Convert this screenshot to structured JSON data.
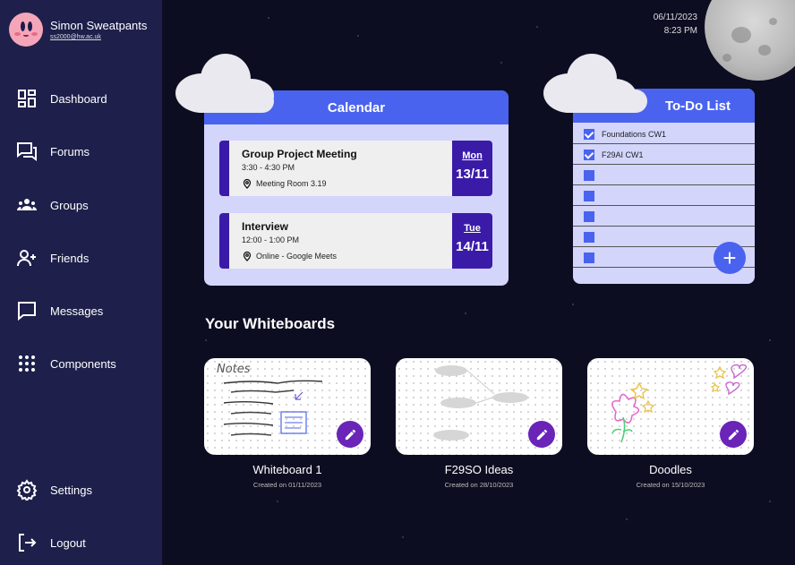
{
  "user": {
    "name": "Simon Sweatpants",
    "email": "ss2000@hw.ac.uk"
  },
  "datetime": {
    "date": "06/11/2023",
    "time": "8:23 PM"
  },
  "nav": [
    {
      "label": "Dashboard",
      "icon": "dashboard-icon"
    },
    {
      "label": "Forums",
      "icon": "forums-icon"
    },
    {
      "label": "Groups",
      "icon": "groups-icon"
    },
    {
      "label": "Friends",
      "icon": "add-friend-icon"
    },
    {
      "label": "Messages",
      "icon": "message-icon"
    },
    {
      "label": "Components",
      "icon": "grid-dots-icon"
    }
  ],
  "nav_bottom": [
    {
      "label": "Settings",
      "icon": "gear-icon"
    },
    {
      "label": "Logout",
      "icon": "logout-icon"
    }
  ],
  "calendar": {
    "title": "Calendar",
    "events": [
      {
        "title": "Group Project Meeting",
        "time": "3:30 - 4:30 PM",
        "location": "Meeting Room 3.19",
        "day": "Mon",
        "date": "13/11"
      },
      {
        "title": "Interview",
        "time": "12:00 - 1:00 PM",
        "location": "Online - Google Meets",
        "day": "Tue",
        "date": "14/11"
      }
    ]
  },
  "todo": {
    "title": "To-Do List",
    "items": [
      {
        "label": "Foundations CW1",
        "checked": true
      },
      {
        "label": "F29AI CW1",
        "checked": true
      },
      {
        "label": "",
        "checked": false
      },
      {
        "label": "",
        "checked": false
      },
      {
        "label": "",
        "checked": false
      },
      {
        "label": "",
        "checked": false
      },
      {
        "label": "",
        "checked": false
      }
    ],
    "add_label": "+"
  },
  "whiteboards": {
    "title": "Your Whiteboards",
    "items": [
      {
        "name": "Whiteboard 1",
        "created": "Created on 01/11/2023",
        "art_text": "Notes"
      },
      {
        "name": "F29SO Ideas",
        "created": "Created on 28/10/2023"
      },
      {
        "name": "Doodles",
        "created": "Created on 15/10/2023"
      }
    ]
  },
  "colors": {
    "accent": "#4a63ee",
    "sidebar": "#1e1f4b",
    "event": "#3a1ba8",
    "edit": "#6a24b8",
    "panel": "#d3d5fb"
  }
}
